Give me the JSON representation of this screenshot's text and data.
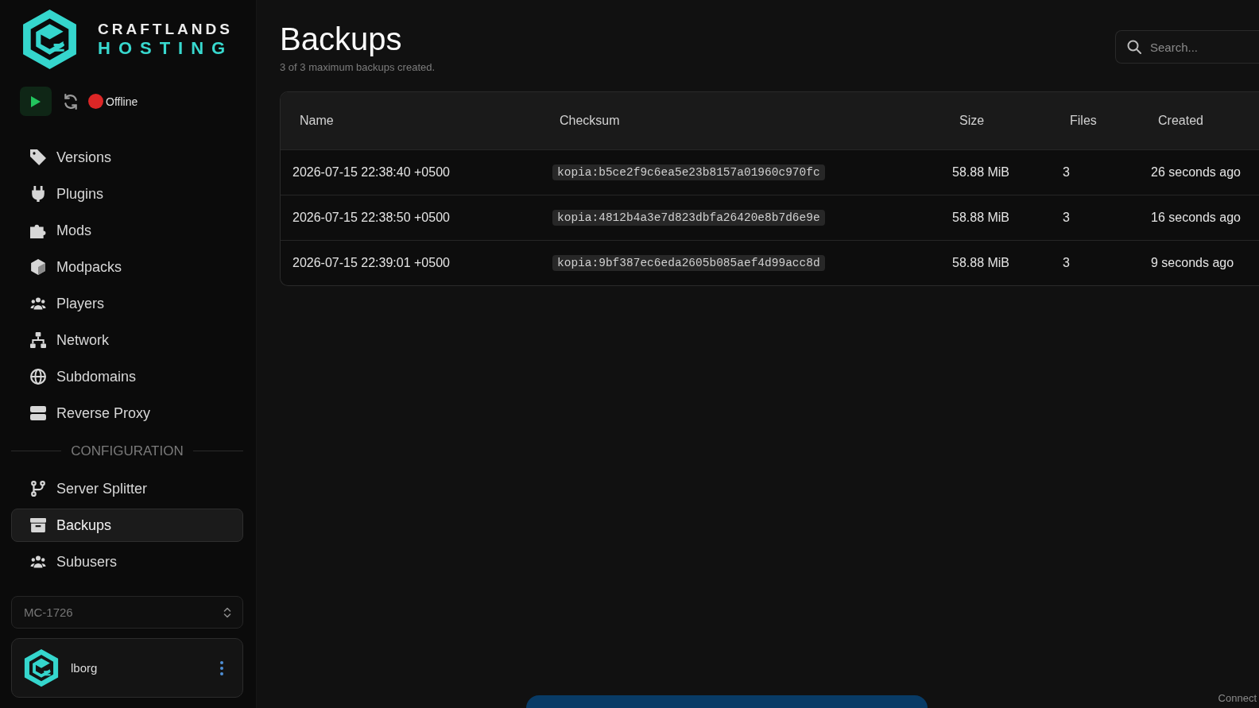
{
  "brand": {
    "line1": "CRAFTLANDS",
    "line2": "HOSTING"
  },
  "server_status": {
    "online": false,
    "label": "Offline"
  },
  "sidebar": {
    "groups": [
      {
        "items": [
          {
            "label": "Versions",
            "selected": false
          },
          {
            "label": "Plugins",
            "selected": false
          },
          {
            "label": "Mods",
            "selected": false
          },
          {
            "label": "Modpacks",
            "selected": false
          },
          {
            "label": "Players",
            "selected": false
          },
          {
            "label": "Network",
            "selected": false
          },
          {
            "label": "Subdomains",
            "selected": false
          },
          {
            "label": "Reverse Proxy",
            "selected": false
          }
        ]
      },
      {
        "title": "CONFIGURATION",
        "items": [
          {
            "label": "Server Splitter",
            "selected": false
          },
          {
            "label": "Backups",
            "selected": true
          },
          {
            "label": "Subusers",
            "selected": false
          }
        ]
      }
    ]
  },
  "server_select": {
    "value": "MC-1726"
  },
  "user": {
    "name": "lborg"
  },
  "page": {
    "title": "Backups",
    "subtitle": "3 of 3 maximum backups created."
  },
  "search": {
    "placeholder": "Search..."
  },
  "table": {
    "columns": [
      {
        "label": "Name",
        "kind": "text"
      },
      {
        "label": "Checksum",
        "kind": "code"
      },
      {
        "label": "Size",
        "kind": "text"
      },
      {
        "label": "Files",
        "kind": "text"
      },
      {
        "label": "Created",
        "kind": "text"
      }
    ],
    "rows": [
      [
        "2026-07-15 22:38:40 +0500",
        "kopia:b5ce2f9c6ea5e23b8157a01960c970fc",
        "58.88 MiB",
        "3",
        "26 seconds ago"
      ],
      [
        "2026-07-15 22:38:50 +0500",
        "kopia:4812b4a3e7d823dbfa26420e8b7d6e9e",
        "58.88 MiB",
        "3",
        "16 seconds ago"
      ],
      [
        "2026-07-15 22:39:01 +0500",
        "kopia:9bf387ec6eda2605b085aef4d99acc8d",
        "58.88 MiB",
        "3",
        "9 seconds ago"
      ]
    ]
  },
  "connection_label": "Connect"
}
